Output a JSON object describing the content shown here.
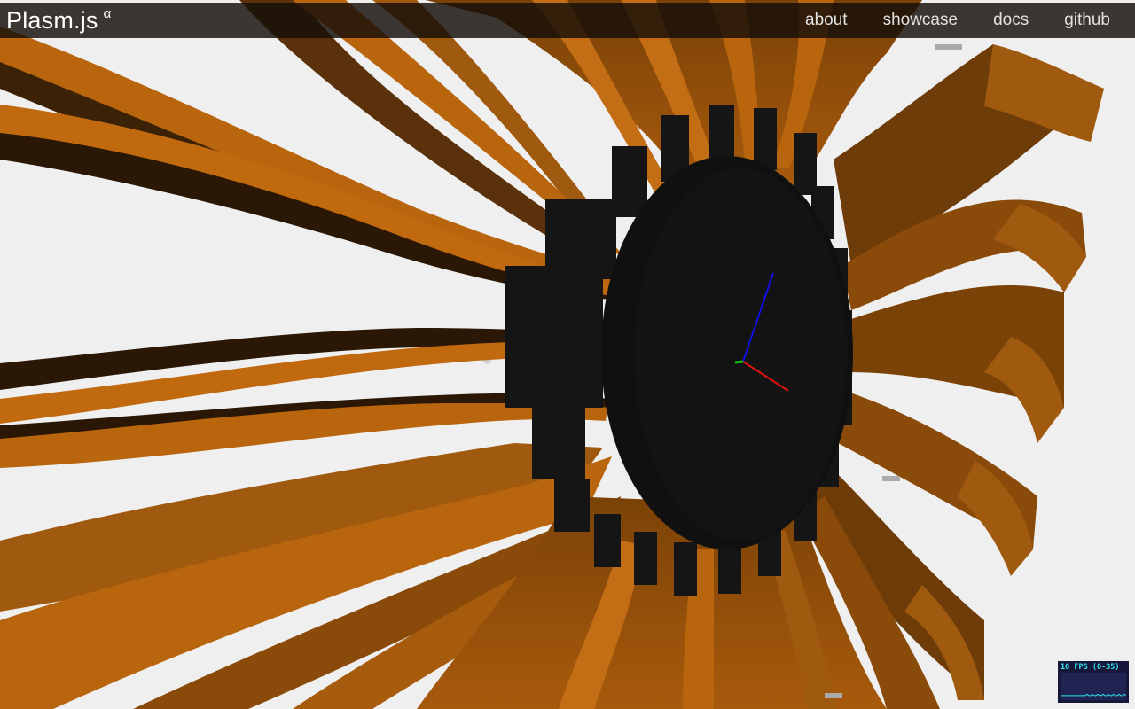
{
  "header": {
    "brand": "Plasm.js",
    "brand_sup": "α",
    "nav": [
      {
        "label": "about"
      },
      {
        "label": "showcase"
      },
      {
        "label": "docs"
      },
      {
        "label": "github"
      }
    ]
  },
  "viewport": {
    "description_colors": {
      "background": "#efefef",
      "ribbon_light": "#b8650e",
      "ribbon_dark": "#4a2a09",
      "hub": "#111111",
      "axis_x": "#e01010",
      "axis_y": "#10c010",
      "axis_z": "#1010e0"
    }
  },
  "fps_meter": {
    "label": "10 FPS (0-35)",
    "current_fps": 10,
    "range": [
      0,
      35
    ],
    "color": "#2de7f0"
  }
}
